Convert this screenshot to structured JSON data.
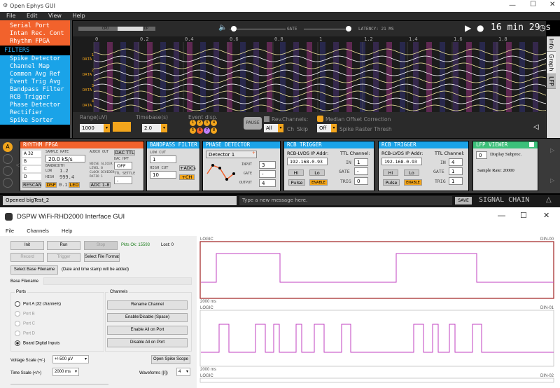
{
  "oe": {
    "title": "Open Ephys GUI",
    "menu": [
      "File",
      "Edit",
      "View",
      "Help"
    ],
    "processor_list": {
      "sources_tail": [
        "Serial Port",
        "Intan Rec. Cont",
        "Rhythm FPGA"
      ],
      "filters_header": "FILTERS",
      "filters": [
        "Spike Detector",
        "Channel Map",
        "Common Avg Ref",
        "Event Trig Avg",
        "Bandpass Filter",
        "RCB Trigger",
        "Phase Detector",
        "Rectifier",
        "Spike Sorter"
      ]
    },
    "toolbar": {
      "cpu": "CPU",
      "dp": "DP",
      "gate": "GATE",
      "latency": "LATENCY: 21 MS",
      "clock": "16 min 29 s"
    },
    "lfp": {
      "time_ticks": [
        "0",
        "0.2",
        "0.4",
        "0.6",
        "0.8",
        "1",
        "1.2",
        "1.4",
        "1.6",
        "1.8"
      ],
      "channel_label": "DATA",
      "channel_numbers": [
        "1",
        "2",
        "3",
        "4"
      ],
      "range_label": "Range(uV)",
      "range_value": "1000",
      "timebase_label": "Timebase(s)",
      "timebase_value": "2.0",
      "event_label": "Event disp.",
      "event_buttons": [
        "1",
        "2",
        "3",
        "4",
        "5",
        "6",
        "7",
        "8"
      ],
      "rev_label": "Rev.",
      "channels_label": "Channels:",
      "ch_label": "Ch",
      "skip_label": "Skip",
      "channels_value": "All",
      "pause_label": "PAUSE",
      "median_label": "Median Offset Correction",
      "spike_raster_label": "Spike Raster Thresh",
      "off_value": "Off",
      "side_tabs": [
        "Info",
        "Graph",
        "LFP"
      ]
    },
    "editors": {
      "rhythm": {
        "title": "RHYTHM FPGA",
        "sample_rate_label": "SAMPLE RATE",
        "sample_rate": "20.0 kS/s",
        "bandwidth_label": "BANDWIDTH",
        "low_label": "LOW",
        "low": "1.2",
        "high_label": "HIGH",
        "high": "999.4",
        "dsp": "DSP",
        "dsp_val": "0.1",
        "led": "LED",
        "audio_out": "AUDIO OUT",
        "dac_ttl": "DAC TTL",
        "dac_hpf": "DAC HPF",
        "off": "OFF",
        "noise_slicer": "NOISE SLICER",
        "level": "LEVEL 0",
        "clock_divider": "CLOCK DIVIDER",
        "ratio": "RATIO 1",
        "adc": "ADC 1-8",
        "ttl_settle": "TTL SETTLE",
        "rescan": "RESCAN",
        "ports": [
          "A",
          "B",
          "C",
          "D"
        ],
        "port_count": "32"
      },
      "bandpass": {
        "title": "BANDPASS FILTER",
        "low_cut_label": "LOW CUT",
        "low_cut": "1",
        "high_cut_label": "HIGH CUT",
        "high_cut": "10",
        "adcs": "+ADCs",
        "ch": "+CH"
      },
      "phase": {
        "title": "PHASE DETECTOR",
        "detector": "Detector 1",
        "input_label": "INPUT",
        "input": "3",
        "gate_label": "GATE",
        "gate": "-",
        "output_label": "OUTPUT",
        "output": "4"
      },
      "rcb1": {
        "title": "RCB TRIGGER",
        "ip_label": "RCB-LVDS IP Addr:",
        "ip": "192.168.0.93",
        "ttl_label": "TTL Channel:",
        "in_label": "IN",
        "in": "1",
        "gate_label": "GATE",
        "gate": "-",
        "trig_label": "TRIG",
        "trig": "0",
        "hi": "Hi",
        "lo": "Lo",
        "pulse": "Pulse",
        "enable": "ENABLE"
      },
      "rcb2": {
        "title": "RCB TRIGGER",
        "ip_label": "RCB-LVDS IP Addr:",
        "ip": "192.168.0.93",
        "ttl_label": "TTL Channel:",
        "in_label": "IN",
        "in": "4",
        "gate_label": "GATE",
        "gate": "1",
        "trig_label": "TRIG",
        "trig": "1",
        "hi": "Hi",
        "lo": "Lo",
        "pulse": "Pulse",
        "enable": "ENABLE"
      },
      "lfpviewer": {
        "title": "LFP VIEWER",
        "subproc": "0",
        "display_label": "Display Subproc.",
        "sample_rate": "Sample Rate: 20000"
      }
    },
    "bottom": {
      "status": "Opened bigTest_2",
      "message_placeholder": "Type a new message here.",
      "save": "SAVE",
      "signal_chain": "SIGNAL CHAIN"
    }
  },
  "dspw": {
    "title": "DSPW WiFi-RHD2000 Interface GUI",
    "menu": [
      "File",
      "Channels",
      "Help"
    ],
    "buttons": {
      "init": "Init",
      "run": "Run",
      "stop": "Stop",
      "record": "Record",
      "trigger": "Trigger",
      "select_file_format": "Select File Format",
      "select_base_filename": "Select Base Filename",
      "rename_channel": "Rename Channel",
      "enable_disable": "Enable/Disable (Space)",
      "enable_all": "Enable All on Port",
      "disable_all": "Disable All on Port",
      "open_spike_scope": "Open Spike Scope"
    },
    "pkts_ok": "Pkts Ok: 15593",
    "lost": "Lost: 0",
    "date_note": "(Date and time stamp will be added)",
    "base_filename_label": "Base Filename",
    "ports_label": "Ports",
    "channels_label": "Channels",
    "ports": [
      "Port A (32 channels)",
      "Port B",
      "Port C",
      "Port D",
      "Board Digital Inputs"
    ],
    "voltage_scale_label": "Voltage Scale (+/-)",
    "voltage_scale": "+/-500 µV",
    "time_scale_label": "Time Scale (</>)",
    "time_scale": "2000 ms",
    "waveforms_label": "Waveforms ([/])",
    "waveforms": "4",
    "plots": [
      {
        "top": "LOGIC",
        "bottom_left": "2000 ms",
        "bottom_right": "DIN-00"
      },
      {
        "top": "LOGIC",
        "bottom_left": "2000 ms",
        "bottom_right": "DIN-01"
      },
      {
        "top": "LOGIC",
        "bottom_left": "",
        "bottom_right": "DIN-02"
      }
    ]
  }
}
